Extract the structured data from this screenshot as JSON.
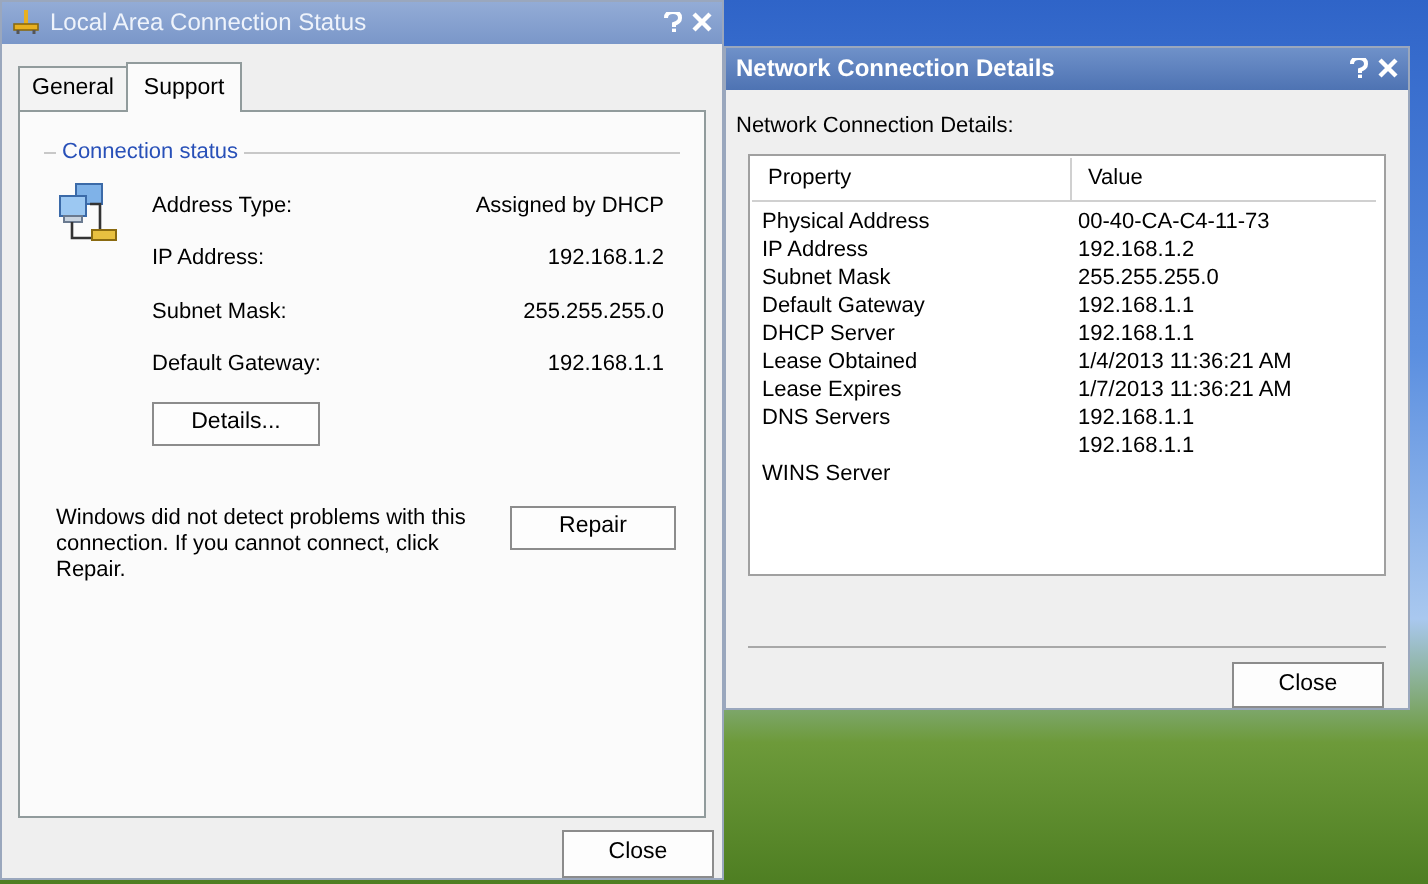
{
  "windows": [
    {
      "title": "Local Area Connection Status",
      "active": false,
      "tabs": [
        {
          "label": "General",
          "selected": false
        },
        {
          "label": "Support",
          "selected": true
        }
      ],
      "group_title": "Connection status",
      "fields": [
        {
          "label": "Address Type:",
          "value": "Assigned by DHCP"
        },
        {
          "label": "IP Address:",
          "value": "192.168.1.2"
        },
        {
          "label": "Subnet Mask:",
          "value": "255.255.255.0"
        },
        {
          "label": "Default Gateway:",
          "value": "192.168.1.1"
        }
      ],
      "details_button": "Details...",
      "message": "Windows did not detect problems with this connection. If you cannot connect, click Repair.",
      "repair_button": "Repair",
      "close_button": "Close"
    },
    {
      "title": "Network Connection Details",
      "active": true,
      "label": "Network Connection Details:",
      "columns": [
        "Property",
        "Value"
      ],
      "rows": [
        {
          "property": "Physical Address",
          "value": "00-40-CA-C4-11-73"
        },
        {
          "property": "IP Address",
          "value": "192.168.1.2"
        },
        {
          "property": "Subnet Mask",
          "value": "255.255.255.0"
        },
        {
          "property": "Default Gateway",
          "value": "192.168.1.1"
        },
        {
          "property": "DHCP Server",
          "value": "192.168.1.1"
        },
        {
          "property": "Lease Obtained",
          "value": "1/4/2013 11:36:21 AM"
        },
        {
          "property": "Lease Expires",
          "value": "1/7/2013 11:36:21 AM"
        },
        {
          "property": "DNS Servers",
          "value": "192.168.1.1"
        },
        {
          "value": "192.168.1.1"
        },
        {
          "property": "WINS Server"
        }
      ],
      "close_button": "Close"
    }
  ]
}
